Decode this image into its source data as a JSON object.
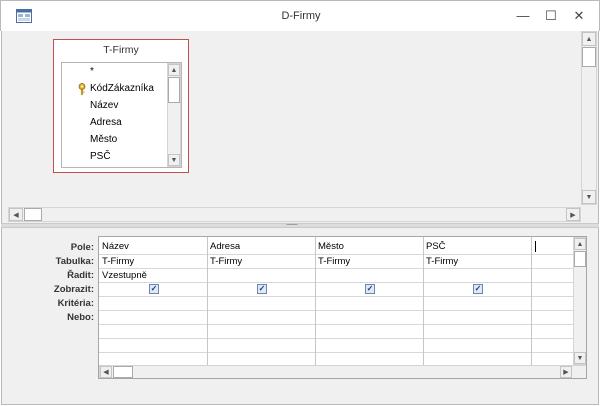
{
  "window": {
    "title": "D-Firmy",
    "minimize": "—",
    "maximize": "☐",
    "close": "✕"
  },
  "table": {
    "title": "T-Firmy",
    "fields": [
      "*",
      "KódZákazníka",
      "Název",
      "Adresa",
      "Město",
      "PSČ"
    ]
  },
  "grid": {
    "row_labels": [
      "Pole:",
      "Tabulka:",
      "Řadit:",
      "Zobrazit:",
      "Kritéria:",
      "Nebo:"
    ],
    "columns": [
      {
        "field": "Název",
        "table": "T-Firmy",
        "sort": "Vzestupně",
        "show": true
      },
      {
        "field": "Adresa",
        "table": "T-Firmy",
        "sort": "",
        "show": true
      },
      {
        "field": "Město",
        "table": "T-Firmy",
        "sort": "",
        "show": true
      },
      {
        "field": "PSČ",
        "table": "T-Firmy",
        "sort": "",
        "show": true
      }
    ]
  },
  "icons": {
    "scroll_up": "▲",
    "scroll_down": "▼",
    "scroll_left": "◀",
    "scroll_right": "▶",
    "check": "✓",
    "grip": "••••••••••"
  }
}
